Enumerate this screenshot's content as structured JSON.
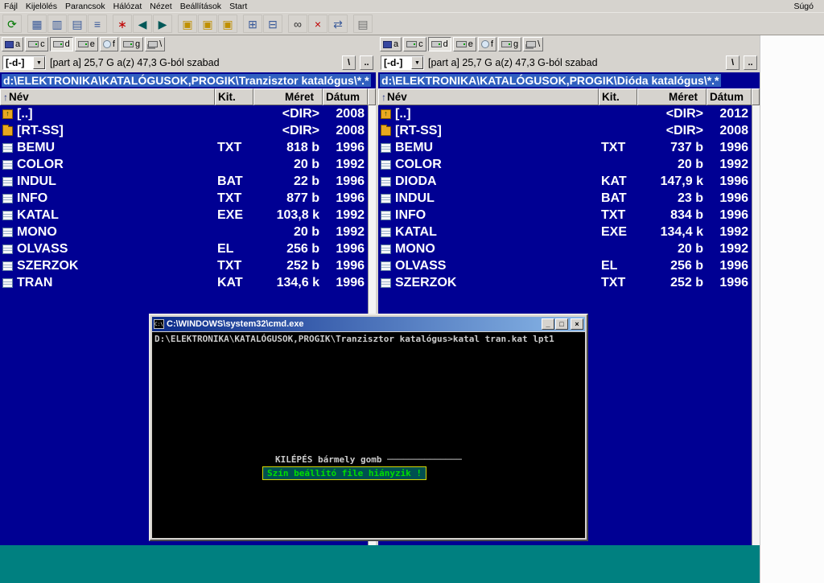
{
  "colors": {
    "chrome": "#d6d3ce",
    "panel_bg": "#000093",
    "path_highlight": "#3060c0",
    "desktop_teal": "#008080",
    "list_text": "#ffffff",
    "console_text": "#cccccc",
    "error_text": "#00dd00",
    "error_border": "#d8d800"
  },
  "menu": {
    "items": [
      "Fájl",
      "Kijelölés",
      "Parancsok",
      "Hálózat",
      "Nézet",
      "Beállítások",
      "Start"
    ],
    "help": "Súgó"
  },
  "toolbar": {
    "groups": [
      [
        {
          "name": "refresh-icon",
          "glyph": "⟳",
          "color": "#007800"
        }
      ],
      [
        {
          "name": "thumbnails-view-icon",
          "glyph": "▦",
          "color": "#3a5a9a"
        },
        {
          "name": "quick-view-icon",
          "glyph": "▥",
          "color": "#3a5a9a"
        },
        {
          "name": "list-view-icon",
          "glyph": "▤",
          "color": "#3a5a9a"
        },
        {
          "name": "tree-view-icon",
          "glyph": "≡",
          "color": "#3a5a9a"
        }
      ],
      [
        {
          "name": "favorites-icon",
          "glyph": "∗",
          "color": "#c00000"
        },
        {
          "name": "back-icon",
          "glyph": "◀",
          "color": "#005858"
        },
        {
          "name": "forward-icon",
          "glyph": "▶",
          "color": "#005858"
        }
      ],
      [
        {
          "name": "pack-files-icon",
          "glyph": "▣",
          "color": "#c09000"
        },
        {
          "name": "unpack-files-icon",
          "glyph": "▣",
          "color": "#c09000"
        },
        {
          "name": "test-archive-icon",
          "glyph": "▣",
          "color": "#c09000"
        }
      ],
      [
        {
          "name": "sort-numeric-icon",
          "glyph": "⊞",
          "color": "#3a5a9a"
        },
        {
          "name": "sort-reverse-icon",
          "glyph": "⊟",
          "color": "#3a5a9a"
        }
      ],
      [
        {
          "name": "search-icon",
          "glyph": "∞",
          "color": "#303030"
        },
        {
          "name": "delete-icon",
          "glyph": "×",
          "color": "#c00000"
        },
        {
          "name": "sync-dirs-icon",
          "glyph": "⇄",
          "color": "#3a5a9a"
        }
      ],
      [
        {
          "name": "notepad-icon",
          "glyph": "▤",
          "color": "#707070"
        }
      ]
    ]
  },
  "drive_buttons": [
    {
      "label": "a",
      "icon": "floppy-icon"
    },
    {
      "label": "c",
      "icon": "hdd-icon"
    },
    {
      "label": "d",
      "icon": "hdd-icon",
      "active": true
    },
    {
      "label": "e",
      "icon": "hdd-icon"
    },
    {
      "label": "f",
      "icon": "cdrom-icon"
    },
    {
      "label": "g",
      "icon": "hdd-icon"
    },
    {
      "label": "\\",
      "icon": "network-icon"
    }
  ],
  "left_panel": {
    "drive_combo": "[-d-]",
    "combo_arrow": "▼",
    "disk_info": "[part a]  25,7 G a(z) 47,3 G-ból szabad",
    "root_button": "\\",
    "up_button": "..",
    "path": "d:\\ELEKTRONIKA\\KATALÓGUSOK,PROGIK\\Tranzisztor katalógus\\*.*",
    "headers": {
      "sort_arrow": "↑",
      "name": "Név",
      "ext": "Kit.",
      "size": "Méret",
      "date": "Dátum"
    },
    "rows": [
      {
        "icon": "updir-icon",
        "name": "[..]",
        "ext": "",
        "size": "<DIR>",
        "date": "2008"
      },
      {
        "icon": "folder-icon",
        "name": "[RT-SS]",
        "ext": "",
        "size": "<DIR>",
        "date": "2008"
      },
      {
        "icon": "file-icon",
        "name": "BEMU",
        "ext": "TXT",
        "size": "818 b",
        "date": "1996"
      },
      {
        "icon": "file-icon",
        "name": "COLOR",
        "ext": "",
        "size": "20 b",
        "date": "1992"
      },
      {
        "icon": "file-icon",
        "name": "INDUL",
        "ext": "BAT",
        "size": "22 b",
        "date": "1996"
      },
      {
        "icon": "file-icon",
        "name": "INFO",
        "ext": "TXT",
        "size": "877 b",
        "date": "1996"
      },
      {
        "icon": "file-icon",
        "name": "KATAL",
        "ext": "EXE",
        "size": "103,8 k",
        "date": "1992"
      },
      {
        "icon": "file-icon",
        "name": "MONO",
        "ext": "",
        "size": "20 b",
        "date": "1992"
      },
      {
        "icon": "file-icon",
        "name": "OLVASS",
        "ext": "EL",
        "size": "256 b",
        "date": "1996"
      },
      {
        "icon": "file-icon",
        "name": "SZERZOK",
        "ext": "TXT",
        "size": "252 b",
        "date": "1996"
      },
      {
        "icon": "file-icon",
        "name": "TRAN",
        "ext": "KAT",
        "size": "134,6 k",
        "date": "1996"
      }
    ]
  },
  "right_panel": {
    "drive_combo": "[-d-]",
    "combo_arrow": "▼",
    "disk_info": "[part a]  25,7 G a(z) 47,3 G-ból szabad",
    "root_button": "\\",
    "up_button": "..",
    "path": "d:\\ELEKTRONIKA\\KATALÓGUSOK,PROGIK\\Dióda katalógus\\*.*",
    "headers": {
      "sort_arrow": "↑",
      "name": "Név",
      "ext": "Kit.",
      "size": "Méret",
      "date": "Dátum"
    },
    "rows": [
      {
        "icon": "updir-icon",
        "name": "[..]",
        "ext": "",
        "size": "<DIR>",
        "date": "2012"
      },
      {
        "icon": "folder-icon",
        "name": "[RT-SS]",
        "ext": "",
        "size": "<DIR>",
        "date": "2008"
      },
      {
        "icon": "file-icon",
        "name": "BEMU",
        "ext": "TXT",
        "size": "737 b",
        "date": "1996"
      },
      {
        "icon": "file-icon",
        "name": "COLOR",
        "ext": "",
        "size": "20 b",
        "date": "1992"
      },
      {
        "icon": "file-icon",
        "name": "DIODA",
        "ext": "KAT",
        "size": "147,9 k",
        "date": "1996"
      },
      {
        "icon": "file-icon",
        "name": "INDUL",
        "ext": "BAT",
        "size": "23 b",
        "date": "1996"
      },
      {
        "icon": "file-icon",
        "name": "INFO",
        "ext": "TXT",
        "size": "834 b",
        "date": "1996"
      },
      {
        "icon": "file-icon",
        "name": "KATAL",
        "ext": "EXE",
        "size": "134,4 k",
        "date": "1992"
      },
      {
        "icon": "file-icon",
        "name": "MONO",
        "ext": "",
        "size": "20 b",
        "date": "1992"
      },
      {
        "icon": "file-icon",
        "name": "OLVASS",
        "ext": "EL",
        "size": "256 b",
        "date": "1996"
      },
      {
        "icon": "file-icon",
        "name": "SZERZOK",
        "ext": "TXT",
        "size": "252 b",
        "date": "1996"
      }
    ]
  },
  "cmd_window": {
    "title": "C:\\WINDOWS\\system32\\cmd.exe",
    "icon_label": "C:\\",
    "minimize": "_",
    "maximize": "□",
    "close": "×",
    "prompt_line": "D:\\ELEKTRONIKA\\KATALÓGUSOK,PROGIK\\Tranzisztor katalógus>katal tran.kat lpt1",
    "exit_label": "KILÉPÉS bármely gomb ",
    "exit_rule": "──────────────",
    "error_message": "Szín beállító file hiányzik !"
  }
}
